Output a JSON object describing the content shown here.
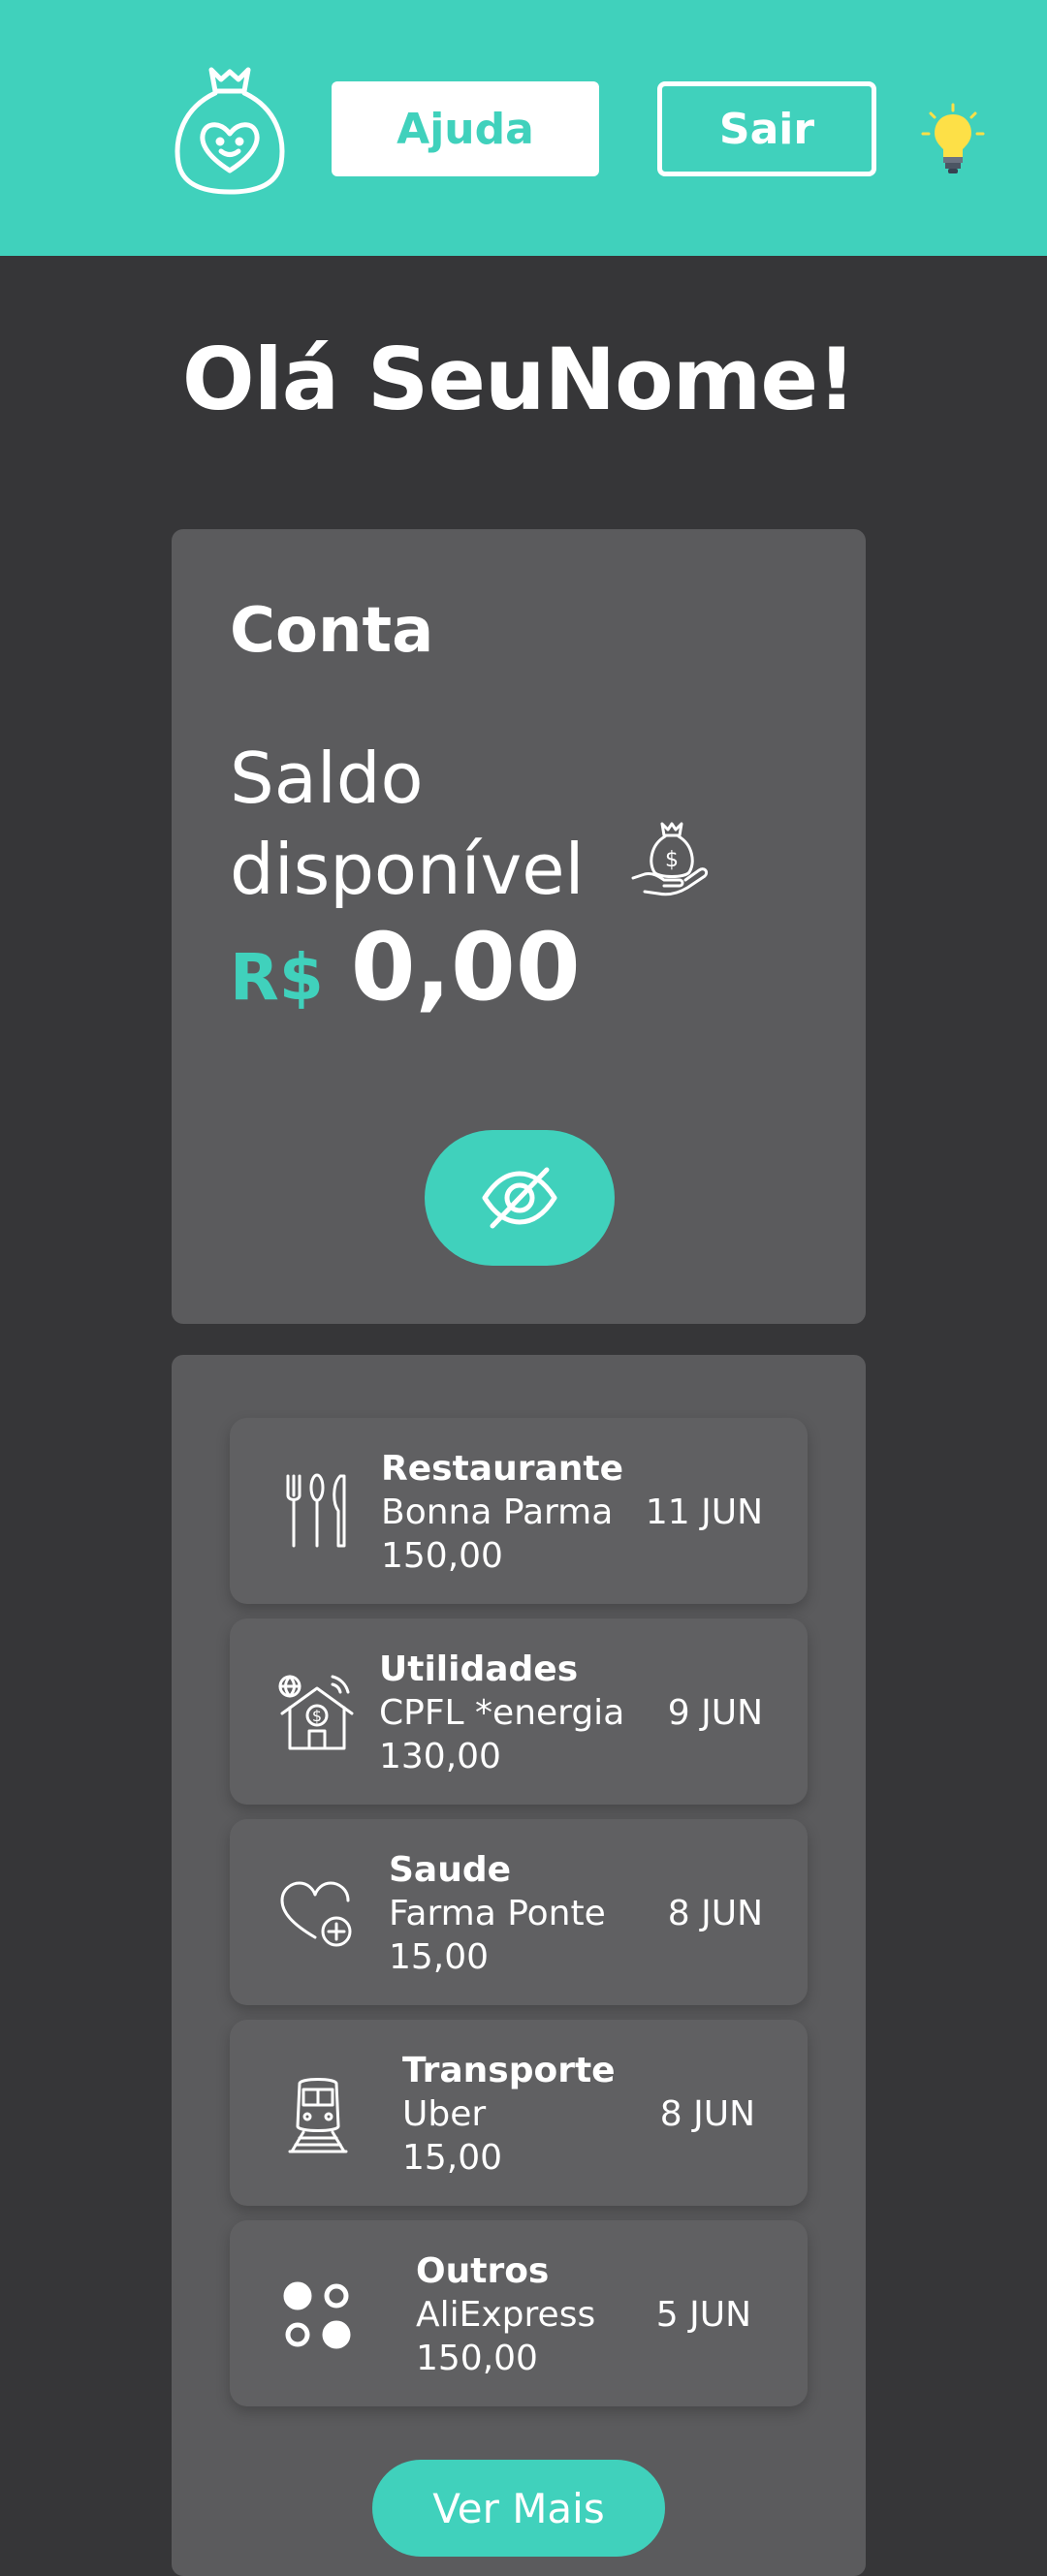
{
  "header": {
    "help_label": "Ajuda",
    "exit_label": "Sair",
    "logo_icon": "money-bag-heart-icon",
    "theme_icon": "lightbulb-icon"
  },
  "greeting": "Olá SeuNome!",
  "account": {
    "title": "Conta",
    "balance_label": "Saldo disponível",
    "currency": "R$",
    "amount": "0,00",
    "balance_icon": "money-bag-hand-icon",
    "toggle_icon": "eye-slash-icon"
  },
  "transactions": [
    {
      "category": "Restaurante",
      "merchant": "Bonna Parma",
      "value": "150,00",
      "date": "11 JUN",
      "icon": "cutlery-icon"
    },
    {
      "category": "Utilidades",
      "merchant": "CPFL *energia",
      "value": "130,00",
      "date": "9 JUN",
      "icon": "house-utilities-icon"
    },
    {
      "category": "Saude",
      "merchant": "Farma Ponte",
      "value": "15,00",
      "date": "8 JUN",
      "icon": "heart-plus-icon"
    },
    {
      "category": "Transporte",
      "merchant": "Uber",
      "value": "15,00",
      "date": "8 JUN",
      "icon": "train-icon"
    },
    {
      "category": "Outros",
      "merchant": "AliExpress",
      "value": "150,00",
      "date": "5 JUN",
      "icon": "dots-icon"
    }
  ],
  "more_label": "Ver Mais",
  "colors": {
    "accent": "#40d1bc",
    "background": "#363638",
    "card": "#5b5b5d",
    "item": "#606062",
    "bulb": "#fde047"
  }
}
